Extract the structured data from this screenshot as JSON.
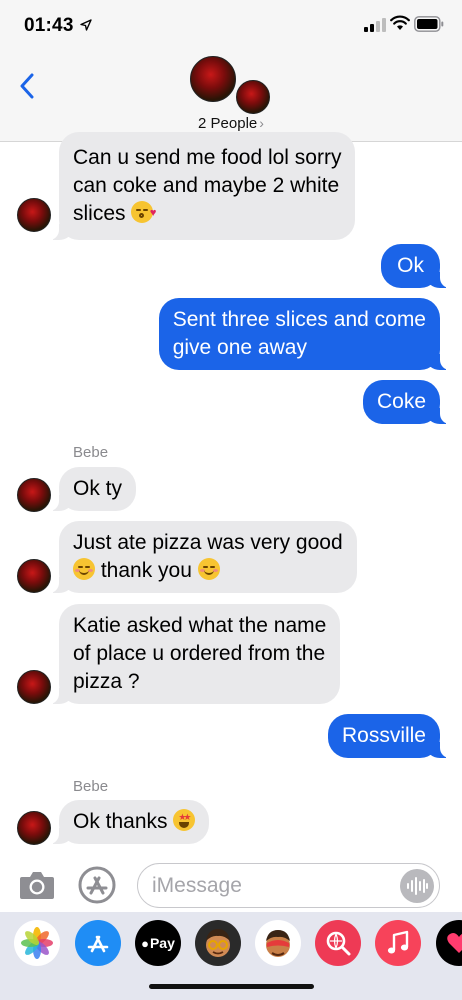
{
  "status_bar": {
    "time": "01:43",
    "icons": [
      "location-arrow-icon",
      "signal-icon",
      "wifi-icon",
      "battery-icon"
    ]
  },
  "header": {
    "back_icon": "chevron-left-icon",
    "people_label": "2 People",
    "people_chevron": "›"
  },
  "messages": [
    {
      "side": "incoming",
      "lines": [
        "Can u send me food lol sorry",
        "can coke and maybe 2 white",
        "slices"
      ],
      "emoji": "kissing-face-emoji"
    },
    {
      "side": "outgoing",
      "lines": [
        "Ok"
      ]
    },
    {
      "side": "outgoing",
      "lines": [
        "Sent three slices and come",
        "give one away"
      ]
    },
    {
      "side": "outgoing",
      "lines": [
        "Coke"
      ]
    },
    {
      "side": "incoming",
      "sender": "Bebe",
      "lines": [
        "Ok ty"
      ]
    },
    {
      "side": "incoming",
      "lines": [
        "Just ate pizza was very good",
        "thank you"
      ],
      "emoji": [
        "relieved-face-emoji",
        "smiling-face-emoji"
      ]
    },
    {
      "side": "incoming",
      "lines": [
        "Katie asked what the name",
        "of place u ordered from the",
        "pizza ?"
      ]
    },
    {
      "side": "outgoing",
      "lines": [
        "Rossville"
      ]
    },
    {
      "side": "incoming",
      "sender": "Bebe",
      "lines": [
        "Ok thanks"
      ],
      "emoji": "star-struck-emoji"
    }
  ],
  "input_bar": {
    "placeholder": "iMessage",
    "camera_icon": "camera-icon",
    "appstore_icon": "app-store-icon",
    "voice_icon": "voice-waveform-icon"
  },
  "app_drawer": {
    "apps": [
      "photos-icon",
      "app-store-icon",
      "apple-pay-icon",
      "memoji-icon",
      "memoji-stickers-icon",
      "web-search-icon",
      "music-icon",
      "digital-touch-icon"
    ],
    "apple_pay_label": "Pay"
  },
  "colors": {
    "outgoing_bubble": "#1b64e8",
    "incoming_bubble": "#e9e9eb",
    "accent": "#1b64e8"
  }
}
